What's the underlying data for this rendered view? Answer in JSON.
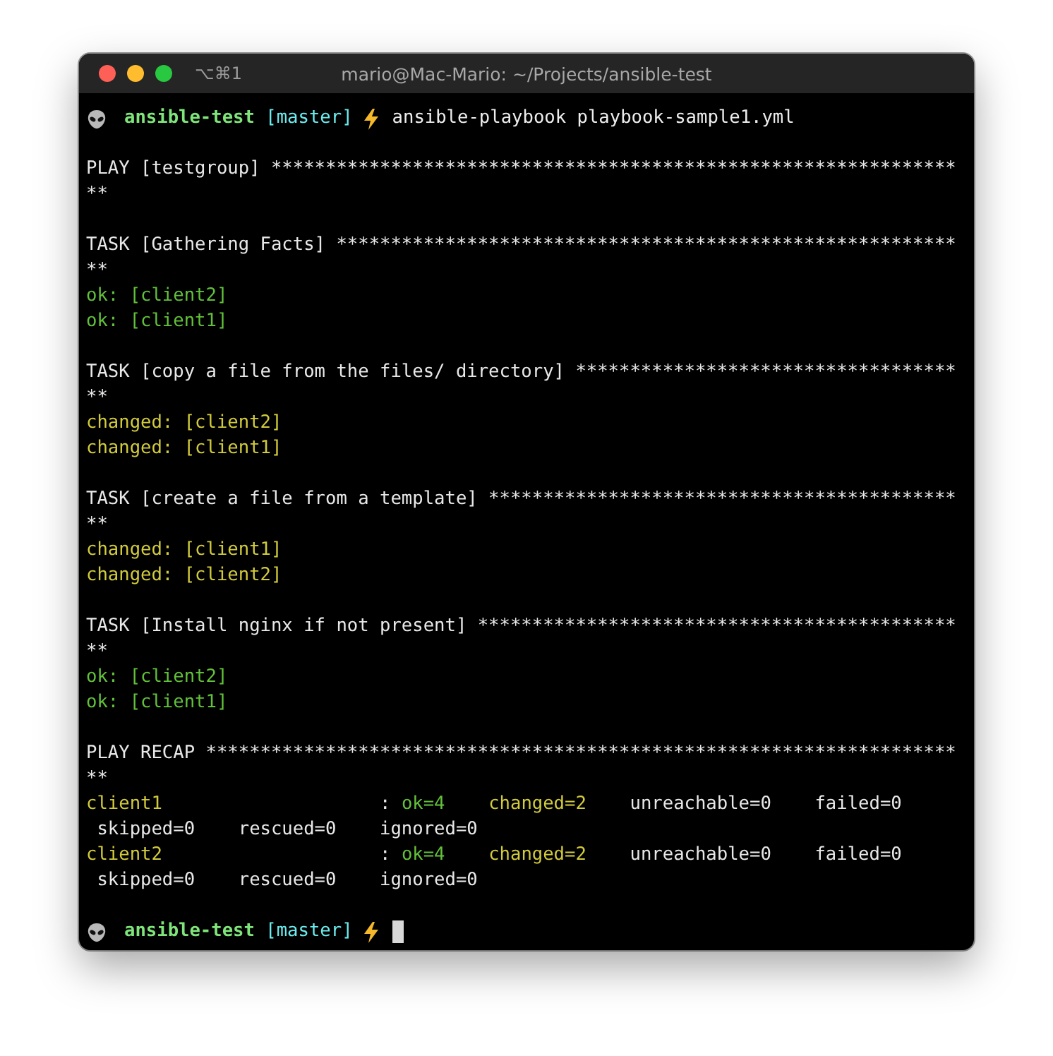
{
  "window": {
    "tab_shortcut": "⌥⌘1",
    "title": "mario@Mac-Mario: ~/Projects/ansible-test"
  },
  "prompt": {
    "directory": "ansible-test",
    "branch": "[master]",
    "command": "ansible-playbook playbook-sample1.yml"
  },
  "lines": [
    {
      "kind": "blank"
    },
    {
      "kind": "text",
      "segments": [
        {
          "kind": "plain",
          "text": "PLAY [testgroup] ***************************************************************"
        }
      ]
    },
    {
      "kind": "text",
      "segments": [
        {
          "kind": "plain",
          "text": "**"
        }
      ]
    },
    {
      "kind": "blank"
    },
    {
      "kind": "text",
      "segments": [
        {
          "kind": "plain",
          "text": "TASK [Gathering Facts] *********************************************************"
        }
      ]
    },
    {
      "kind": "text",
      "segments": [
        {
          "kind": "plain",
          "text": "**"
        }
      ]
    },
    {
      "kind": "text",
      "segments": [
        {
          "kind": "ok",
          "text": "ok: [client2]"
        }
      ]
    },
    {
      "kind": "text",
      "segments": [
        {
          "kind": "ok",
          "text": "ok: [client1]"
        }
      ]
    },
    {
      "kind": "blank"
    },
    {
      "kind": "text",
      "segments": [
        {
          "kind": "plain",
          "text": "TASK [copy a file from the files/ directory] ***********************************"
        }
      ]
    },
    {
      "kind": "text",
      "segments": [
        {
          "kind": "plain",
          "text": "**"
        }
      ]
    },
    {
      "kind": "text",
      "segments": [
        {
          "kind": "changed",
          "text": "changed: [client2]"
        }
      ]
    },
    {
      "kind": "text",
      "segments": [
        {
          "kind": "changed",
          "text": "changed: [client1]"
        }
      ]
    },
    {
      "kind": "blank"
    },
    {
      "kind": "text",
      "segments": [
        {
          "kind": "plain",
          "text": "TASK [create a file from a template] *******************************************"
        }
      ]
    },
    {
      "kind": "text",
      "segments": [
        {
          "kind": "plain",
          "text": "**"
        }
      ]
    },
    {
      "kind": "text",
      "segments": [
        {
          "kind": "changed",
          "text": "changed: [client1]"
        }
      ]
    },
    {
      "kind": "text",
      "segments": [
        {
          "kind": "changed",
          "text": "changed: [client2]"
        }
      ]
    },
    {
      "kind": "blank"
    },
    {
      "kind": "text",
      "segments": [
        {
          "kind": "plain",
          "text": "TASK [Install nginx if not present] ********************************************"
        }
      ]
    },
    {
      "kind": "text",
      "segments": [
        {
          "kind": "plain",
          "text": "**"
        }
      ]
    },
    {
      "kind": "text",
      "segments": [
        {
          "kind": "ok",
          "text": "ok: [client2]"
        }
      ]
    },
    {
      "kind": "text",
      "segments": [
        {
          "kind": "ok",
          "text": "ok: [client1]"
        }
      ]
    },
    {
      "kind": "blank"
    },
    {
      "kind": "text",
      "segments": [
        {
          "kind": "plain",
          "text": "PLAY RECAP *********************************************************************"
        }
      ]
    },
    {
      "kind": "text",
      "segments": [
        {
          "kind": "plain",
          "text": "**"
        }
      ]
    },
    {
      "kind": "text",
      "segments": [
        {
          "kind": "changed",
          "text": "client1"
        },
        {
          "kind": "plain",
          "text": "                    : "
        },
        {
          "kind": "ok",
          "text": "ok=4"
        },
        {
          "kind": "changed",
          "text": "    changed=2"
        },
        {
          "kind": "plain",
          "text": "    unreachable=0    failed=0"
        }
      ]
    },
    {
      "kind": "text",
      "segments": [
        {
          "kind": "plain",
          "text": " skipped=0    rescued=0    ignored=0"
        }
      ]
    },
    {
      "kind": "text",
      "segments": [
        {
          "kind": "changed",
          "text": "client2"
        },
        {
          "kind": "plain",
          "text": "                    : "
        },
        {
          "kind": "ok",
          "text": "ok=4"
        },
        {
          "kind": "changed",
          "text": "    changed=2"
        },
        {
          "kind": "plain",
          "text": "    unreachable=0    failed=0"
        }
      ]
    },
    {
      "kind": "text",
      "segments": [
        {
          "kind": "plain",
          "text": " skipped=0    rescued=0    ignored=0"
        }
      ]
    },
    {
      "kind": "blank"
    }
  ],
  "final_prompt": {
    "directory": "ansible-test",
    "branch": "[master]",
    "cursor": true
  }
}
